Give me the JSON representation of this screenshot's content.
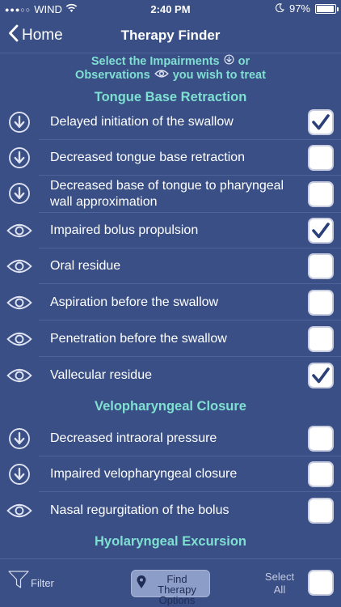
{
  "status_bar": {
    "signal_dots": "●●●○○",
    "carrier": "WIND",
    "time": "2:40 PM",
    "battery_percent": "97%",
    "battery_level": 0.97,
    "icons": [
      "wifi-icon",
      "moon-icon",
      "battery-icon"
    ]
  },
  "nav": {
    "back_label": "Home",
    "title": "Therapy Finder"
  },
  "instruction": {
    "line1_prefix": "Select the Impairments",
    "line1_suffix": "or",
    "line2_prefix": "Observations",
    "line2_suffix": "you wish to treat"
  },
  "sections": [
    {
      "title": "Tongue Base Retraction",
      "items": [
        {
          "type": "impairment",
          "label": "Delayed initiation of the swallow",
          "checked": true
        },
        {
          "type": "impairment",
          "label": "Decreased tongue base retraction",
          "checked": false
        },
        {
          "type": "impairment",
          "label": "Decreased base of tongue to pharyngeal wall approximation",
          "checked": false
        },
        {
          "type": "observation",
          "label": "Impaired bolus propulsion",
          "checked": true
        },
        {
          "type": "observation",
          "label": "Oral residue",
          "checked": false
        },
        {
          "type": "observation",
          "label": "Aspiration before the swallow",
          "checked": false
        },
        {
          "type": "observation",
          "label": "Penetration before the swallow",
          "checked": false
        },
        {
          "type": "observation",
          "label": "Vallecular residue",
          "checked": true
        }
      ]
    },
    {
      "title": "Velopharyngeal Closure",
      "items": [
        {
          "type": "impairment",
          "label": "Decreased intraoral pressure",
          "checked": false
        },
        {
          "type": "impairment",
          "label": "Impaired velopharyngeal closure",
          "checked": false
        },
        {
          "type": "observation",
          "label": "Nasal regurgitation of the bolus",
          "checked": false
        }
      ]
    },
    {
      "title": "Hyolaryngeal Excursion",
      "items": []
    }
  ],
  "toolbar": {
    "filter_label": "Filter",
    "find_therapy_line1": "Find Therapy",
    "find_therapy_line2": "Options",
    "select_all_line1": "Select",
    "select_all_line2": "All"
  },
  "colors": {
    "background": "#3a4f85",
    "accent_text": "#7fe0d2",
    "checkmark": "#2b3f78",
    "separator": "#4d639a"
  }
}
